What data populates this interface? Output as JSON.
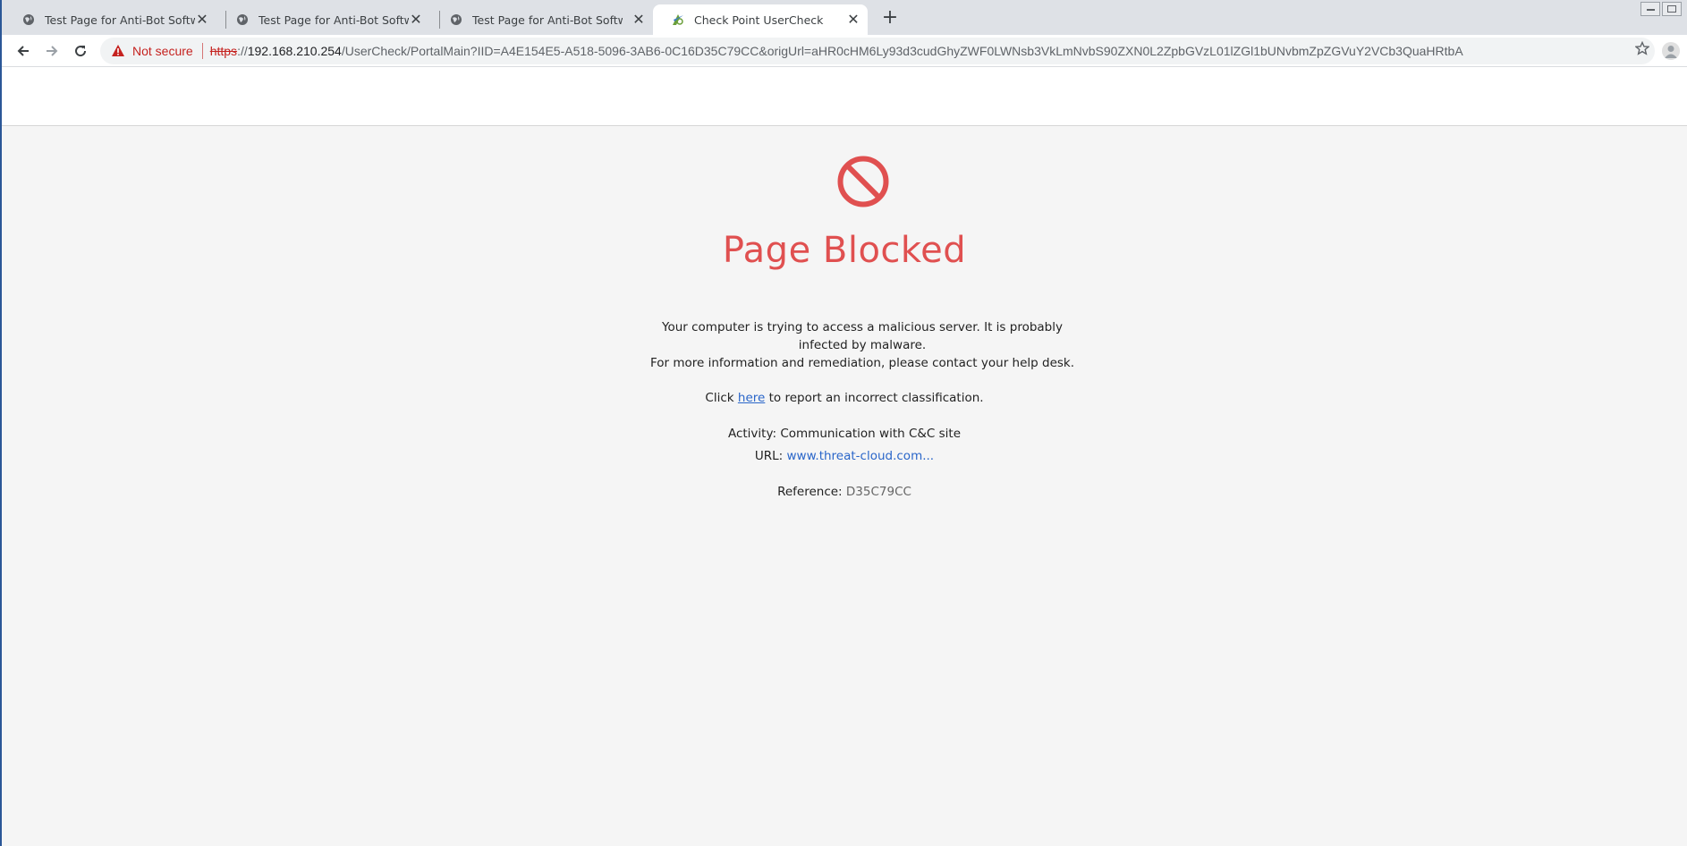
{
  "browser": {
    "tabs": [
      {
        "title": "Test Page for Anti-Bot Software B",
        "active": false
      },
      {
        "title": "Test Page for Anti-Bot Software B",
        "active": false
      },
      {
        "title": "Test Page for Anti-Bot Software B",
        "active": false
      },
      {
        "title": "Check Point UserCheck",
        "active": true
      }
    ],
    "new_tab_label": "+",
    "security_label": "Not secure",
    "url": {
      "scheme": "https",
      "separator": "://",
      "host": "192.168.210.254",
      "rest": "/UserCheck/PortalMain?IID=A4E154E5-A518-5096-3AB6-0C16D35C79CC&origUrl=aHR0cHM6Ly93d3cudGhyZWF0LWNsb3VkLmNvbS90ZXN0L2ZpbGVzL01lZGl1bUNvbmZpZGVuY2VCb3QuaHRtbA"
    }
  },
  "colors": {
    "accent_red": "#e05050",
    "link_blue": "#2a66c9",
    "insecure_red": "#c5221f"
  },
  "blocked_page": {
    "headline": "Page Blocked",
    "message_line1": "Your computer is trying to access a malicious server. It is probably infected by malware.",
    "message_line2": "For more information and remediation, please contact your help desk.",
    "report_prefix": "Click ",
    "report_link": "here",
    "report_suffix": " to report an incorrect classification.",
    "activity_label": "Activity: ",
    "activity_value": "Communication with C&C site",
    "url_label": "URL: ",
    "url_value": "www.threat-cloud.com...",
    "reference_label": "Reference: ",
    "reference_value": "D35C79CC"
  }
}
